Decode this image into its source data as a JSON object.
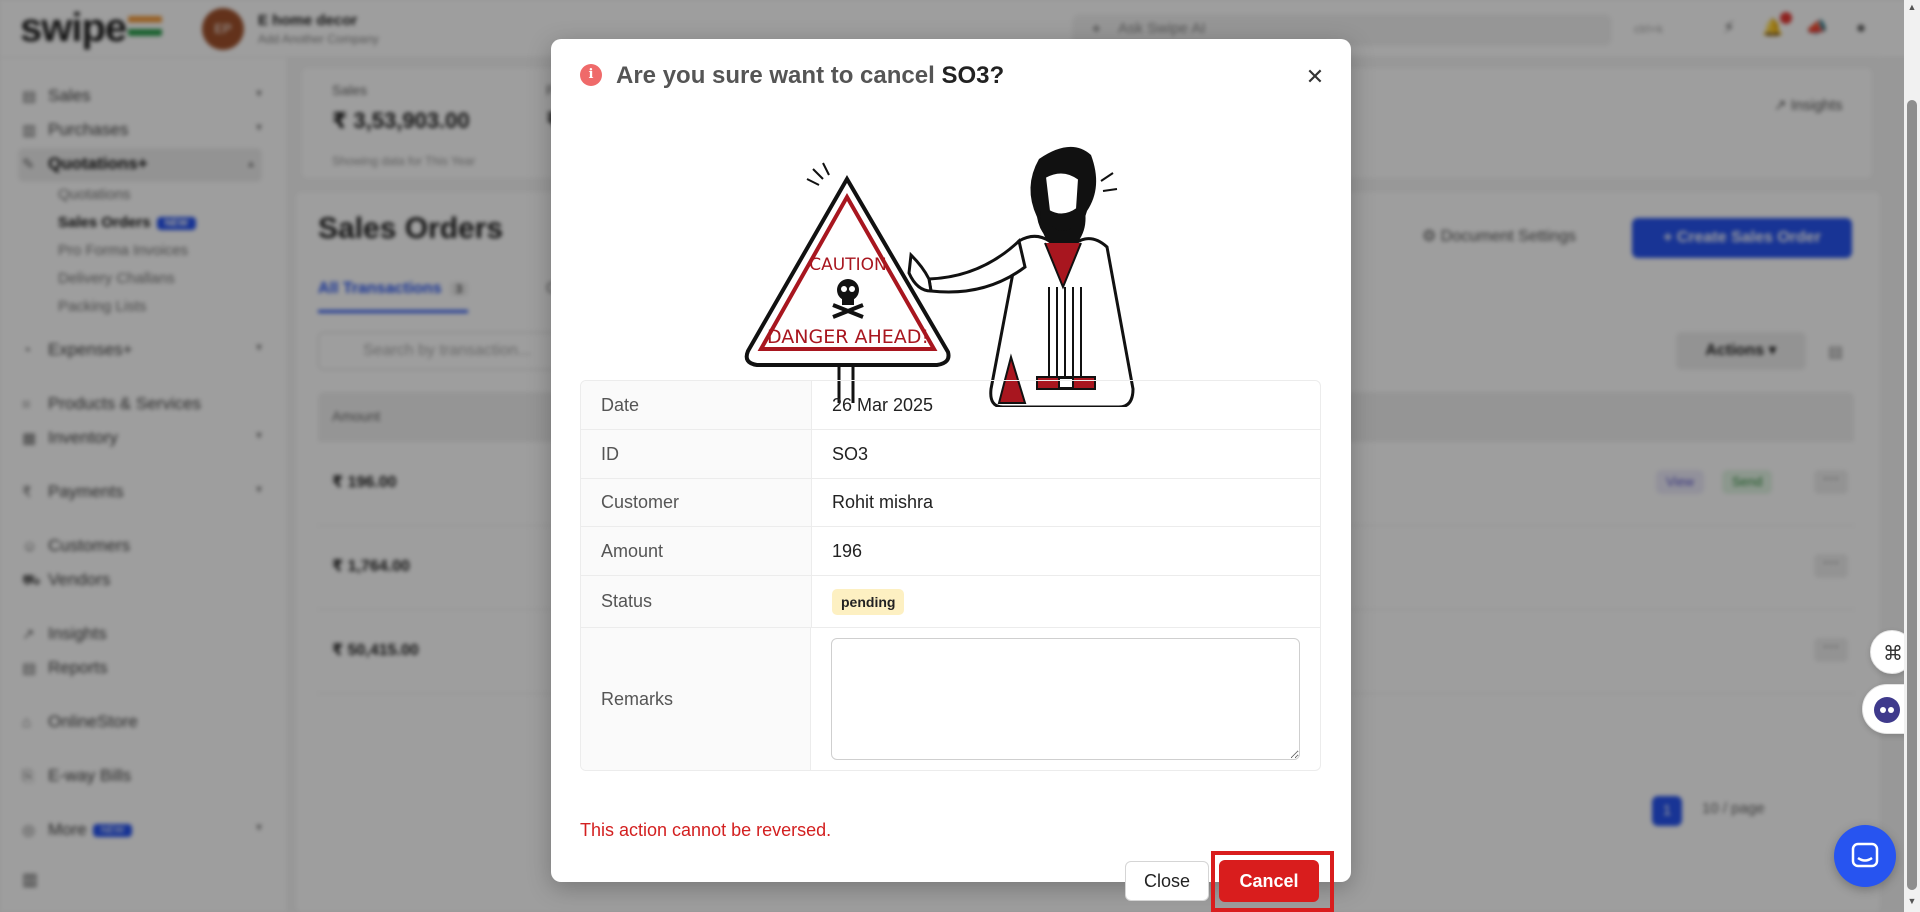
{
  "app": {
    "logo": "swipe",
    "company_initials": "EP",
    "company_name": "E home decor",
    "add_company": "Add Another Company",
    "search_placeholder": "Ask Swipe AI",
    "search_shortcut": "ctrl+k"
  },
  "sidebar": {
    "items": [
      {
        "label": "Sales"
      },
      {
        "label": "Purchases"
      },
      {
        "label": "Quotations+"
      },
      {
        "label": "Expenses+"
      },
      {
        "label": "Products & Services"
      },
      {
        "label": "Inventory"
      },
      {
        "label": "Payments"
      },
      {
        "label": "Customers"
      },
      {
        "label": "Vendors"
      },
      {
        "label": "Insights"
      },
      {
        "label": "Reports"
      },
      {
        "label": "OnlineStore"
      },
      {
        "label": "E-way Bills"
      },
      {
        "label": "More"
      }
    ],
    "sub_items": [
      {
        "label": "Quotations"
      },
      {
        "label": "Sales Orders",
        "badge": "NEW"
      },
      {
        "label": "Pro Forma Invoices"
      },
      {
        "label": "Delivery Challans"
      },
      {
        "label": "Packing Lists"
      }
    ],
    "more_badge": "NEW"
  },
  "summary": {
    "sales_label": "Sales",
    "sales_value": "₹ 3,53,903.00",
    "note": "Showing data for This Year",
    "second_label": "Pa",
    "second_value": "₹ (",
    "insights_label": "Insights"
  },
  "list": {
    "title": "Sales Orders",
    "document_settings": "Document Settings",
    "create_button": "+ Create Sales Order",
    "tab_all": "All Transactions",
    "tab_all_count": "3",
    "tab_other": "C",
    "search_placeholder": "Search by transaction...",
    "actions_label": "Actions",
    "col_amount": "Amount",
    "rows": [
      {
        "amount": "₹ 196.00",
        "view": "View",
        "send": "Send"
      },
      {
        "amount": "₹ 1,764.00"
      },
      {
        "amount": "₹ 50,415.00"
      }
    ],
    "page": "1",
    "page_size": "10 / page"
  },
  "modal": {
    "title_prefix": "Are you sure want to cancel",
    "title_id": "SO3?",
    "fields": {
      "date_label": "Date",
      "date_value": "26 Mar 2025",
      "id_label": "ID",
      "id_value": "SO3",
      "customer_label": "Customer",
      "customer_value": "Rohit mishra",
      "amount_label": "Amount",
      "amount_value": "196",
      "status_label": "Status",
      "status_value": "pending",
      "remarks_label": "Remarks",
      "remarks_value": ""
    },
    "illustration_text_1": "CAUTION",
    "illustration_text_2": "DANGER AHEAD!",
    "warning": "This action cannot be reversed.",
    "close_label": "Close",
    "cancel_label": "Cancel"
  },
  "colors": {
    "accent": "#2754f0",
    "danger": "#d91d1d",
    "pending_bg": "#fdf0c2"
  }
}
